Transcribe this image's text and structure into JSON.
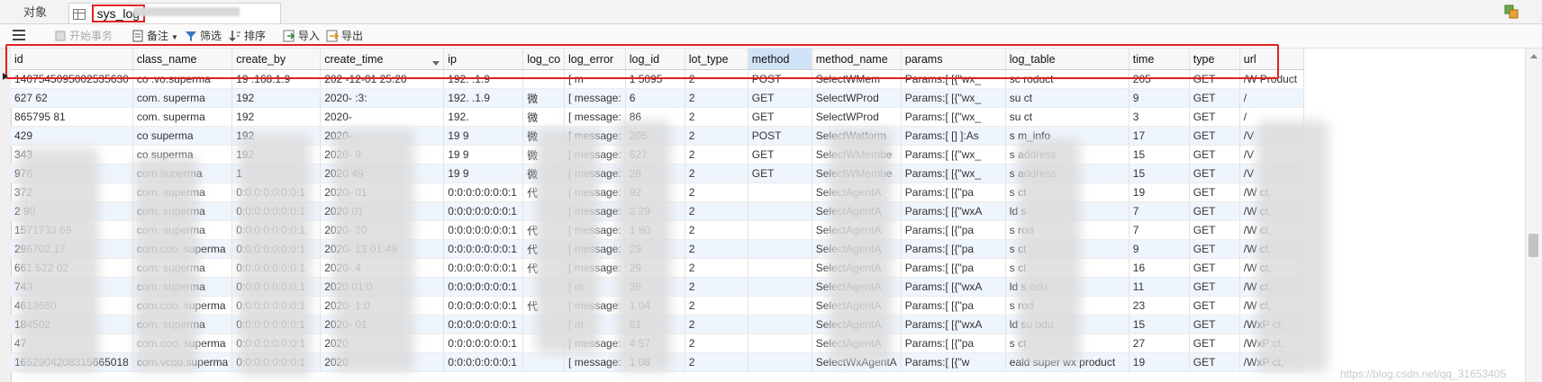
{
  "tabs": {
    "objects": "对象",
    "syslog": "sys_log"
  },
  "toolbar": {
    "begin_txn": "开始事务",
    "note": "备注",
    "filter": "筛选",
    "sort": "排序",
    "import": "导入",
    "export": "导出"
  },
  "columns": [
    "id",
    "class_name",
    "create_by",
    "create_time",
    "ip",
    "log_co",
    "log_error",
    "log_id",
    "lot_type",
    "method",
    "method_name",
    "params",
    "log_table",
    "time",
    "type",
    "url"
  ],
  "rows": [
    [
      "1407545095002535630",
      "co   .vo.superma",
      "19  .168.1.9",
      "202  -12-01 25:20",
      "192.  .1.9",
      "",
      "[ m",
      "1   5095",
      "2",
      "POST",
      "SelectWMem",
      "Params:[ [{\"wx_",
      "sc   roduct",
      "205",
      "GET",
      "/W Product"
    ],
    [
      "627    62",
      "com.   superma",
      "192",
      "2020-   :3:",
      "192.   .1.9",
      "微  ",
      "[ message:",
      "6",
      "2",
      "GET",
      "SelectWProd",
      "Params:[ [{\"wx_",
      "su   ct",
      "9",
      "GET",
      "/"
    ],
    [
      "865795   81",
      "com.   superma",
      "192",
      "2020-",
      "192.",
      "微  ",
      "[ message:",
      "86",
      "2",
      "GET",
      "SelectWProd",
      "Params:[ [{\"wx_",
      "su   ct",
      "3",
      "GET",
      "/"
    ],
    [
      "   429",
      "co   superma",
      "192",
      "2020-",
      "19  9",
      "微  ",
      "[ message:",
      "205",
      "2",
      "POST",
      "SelectWatform",
      "Params:[ [] ]:As",
      "s   m_info",
      "17",
      "GET",
      "/V"
    ],
    [
      "   343",
      "co   superma",
      "192",
      "2020-   9",
      "19  9",
      "微  ",
      "[ message:",
      "627",
      "2",
      "GET",
      "SelectWMembe",
      "Params:[ [{\"wx_",
      "s   address",
      "15",
      "GET",
      "/V"
    ],
    [
      "   976",
      "com   superma",
      "1",
      "2020   49",
      "19  9",
      "微  ",
      "[ message:",
      "28",
      "2",
      "GET",
      "SelectWMembe",
      "Params:[ [{\"wx_",
      "s   address",
      "15",
      "GET",
      "/V"
    ],
    [
      "   372",
      "com.   superma",
      "0:0:0:0:0:0:0:1",
      "2020-   01",
      "0:0:0:0:0:0:0:1",
      "代",
      "[ message:",
      "92",
      "2",
      "",
      "SelectAgentA",
      "Params:[ [{\"pa",
      "s   ct",
      "19",
      "GET",
      "/W ct,"
    ],
    [
      "2   90",
      "com.   superma",
      "0:0:0:0:0:0:0:1",
      "2020   01",
      "0:0:0:0:0:0:0:1",
      "",
      "[ message:",
      "2  29",
      "2",
      "",
      "SelectAgentA",
      "Params:[ [{\"wxA",
      "ld s",
      "7",
      "GET",
      "/W ct,"
    ],
    [
      "1571733   69",
      "com.   superma",
      "0:0:0:0:0:0:0:1",
      "2020-   20",
      "0:0:0:0:0:0:0:1",
      "代",
      "[ message:",
      "1  80",
      "2",
      "",
      "SelectAgentA",
      "Params:[ [{\"pa",
      "s   rod",
      "7",
      "GET",
      "/W ct,"
    ],
    [
      "296702   17",
      "com.coo.   superma",
      "0:0:0:0:0:0:0:1",
      "2020-   13 01:49",
      "0:0:0:0:0:0:0:1",
      "代",
      "[ message:",
      "29",
      "2",
      "",
      "SelectAgentA",
      "Params:[ [{\"pa",
      "s   ct",
      "9",
      "GET",
      "/W ct,"
    ],
    [
      "661   522   02",
      "com.   superma",
      "0:0:0:0:0:0:0:1",
      "2020-   4",
      "0:0:0:0:0:0:0:1",
      "代",
      "[ message:",
      "29",
      "2",
      "",
      "SelectAgentA",
      "Params:[ [{\"pa",
      "s   ct",
      "16",
      "GET",
      "/W ct,"
    ],
    [
      "   743",
      "com.   superma",
      "0:0:0:0:0:0:0:1",
      "2020   01:0",
      "0:0:0:0:0:0:0:1",
      "",
      "[ m",
      "36",
      "2",
      "",
      "SelectAgentA",
      "Params:[ [{\"wxA",
      "ld s   odu",
      "11",
      "GET",
      "/W ct,"
    ],
    [
      "   4613660",
      "com.coo.   superma",
      "0:0:0:0:0:0:0:1",
      "2020-   1:0",
      "0:0:0:0:0:0:0:1",
      "代",
      "[ message:",
      "1   04",
      "2",
      "",
      "SelectAgentA",
      "Params:[ [{\"pa",
      "s   rod",
      "23",
      "GET",
      "/W ct,"
    ],
    [
      "   184502",
      "com.   superma",
      "0:0:0:0:0:0:0:1",
      "2020-   01",
      "0:0:0:0:0:0:0:1",
      "",
      "[ m",
      "61",
      "2",
      "",
      "SelectAgentA",
      "Params:[ [{\"wxA",
      "ld su   odu",
      "15",
      "GET",
      "/WxP ct,"
    ],
    [
      "   47",
      "com.coo.   superma",
      "0:0:0:0:0:0:0:1",
      "2020",
      "0:0:0:0:0:0:0:1",
      "",
      "[ message:",
      "4   57",
      "2",
      "",
      "SelectAgentA",
      "Params:[ [{\"pa",
      "s   ct",
      "27",
      "GET",
      "/WxP ct,"
    ],
    [
      "1652904208315665018",
      "com.vcoo.superma",
      "0:0:0:0:0:0:0:1",
      "2020",
      "0:0:0:0:0:0:0:1",
      "",
      "[ message:",
      "1   08",
      "2",
      "",
      "SelectWxAgentA",
      "Params:[ [{\"w",
      "eald super wx product",
      "19",
      "GET",
      "/WxP ct,"
    ]
  ],
  "selected_column": "method",
  "sorted_column": "create_time",
  "watermark": "https://blog.csdn.net/qq_31653405"
}
